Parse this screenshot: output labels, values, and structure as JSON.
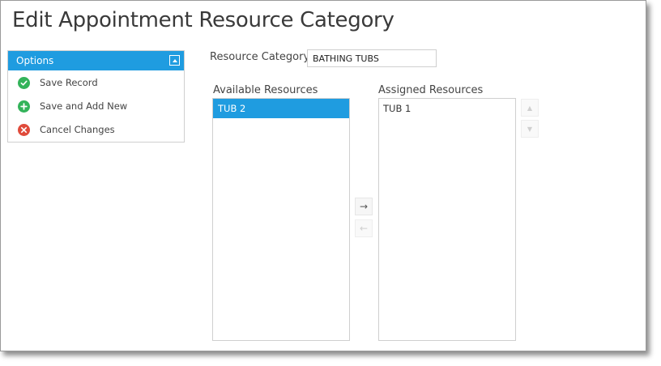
{
  "page": {
    "title": "Edit Appointment Resource Category"
  },
  "options": {
    "header": "Options",
    "items": [
      {
        "label": "Save Record",
        "icon": "check-icon",
        "color": "#33b35a"
      },
      {
        "label": "Save and Add New",
        "icon": "plus-icon",
        "color": "#33b35a"
      },
      {
        "label": "Cancel Changes",
        "icon": "x-icon",
        "color": "#e04b3b"
      }
    ]
  },
  "form": {
    "resource_category_label": "Resource Category",
    "resource_category_value": "BATHING TUBS"
  },
  "available": {
    "label": "Available Resources",
    "items": [
      {
        "label": "TUB 2",
        "selected": true
      }
    ]
  },
  "assigned": {
    "label": "Assigned Resources",
    "items": [
      {
        "label": "TUB 1",
        "selected": false
      }
    ]
  },
  "buttons": {
    "move_right": "→",
    "move_left": "←",
    "move_up": "▲",
    "move_down": "▼"
  },
  "colors": {
    "accent": "#1f9ce0",
    "success": "#33b35a",
    "danger": "#e04b3b"
  }
}
